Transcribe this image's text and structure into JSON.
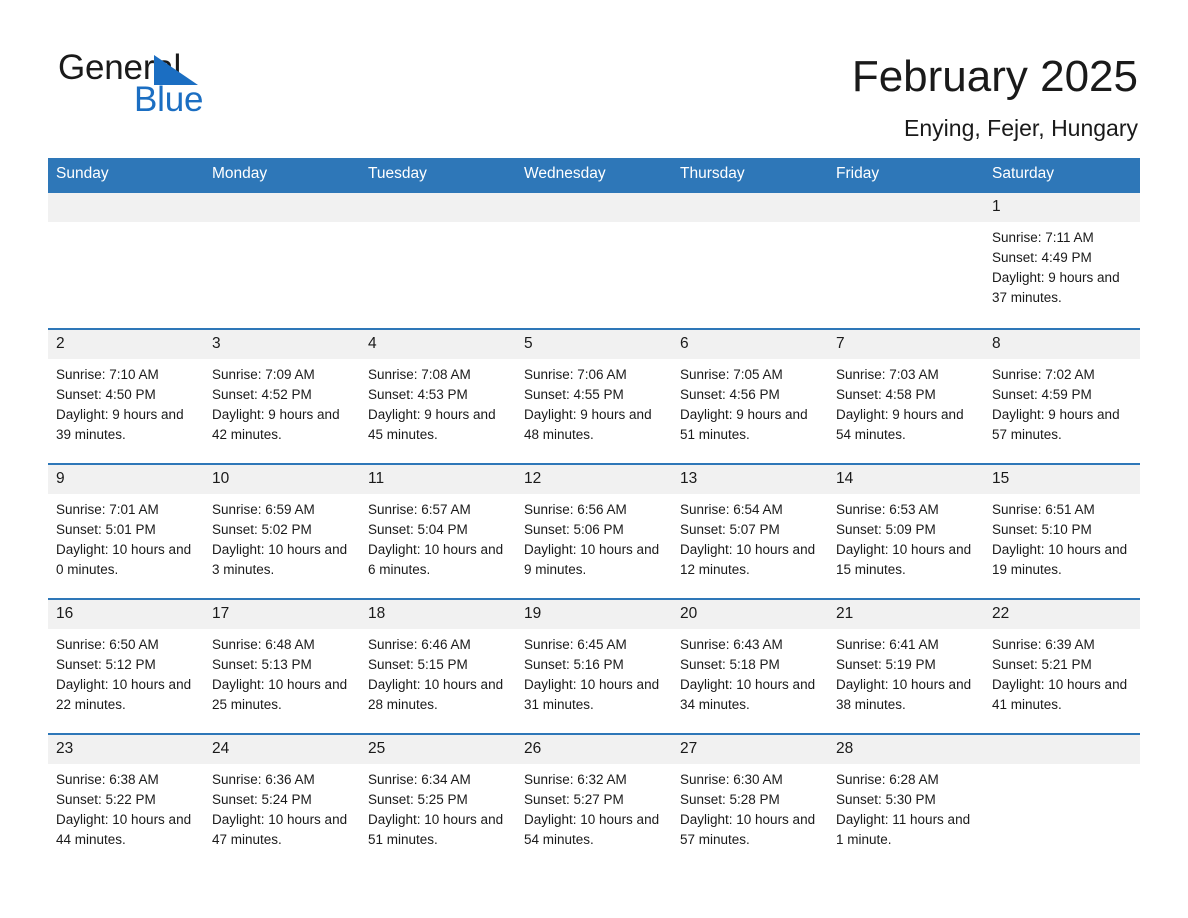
{
  "brand": {
    "word_one": "General",
    "word_two": "Blue",
    "accent_color": "#1b6ec2",
    "triangle_icon": "triangle-flag-icon"
  },
  "header": {
    "month_title": "February 2025",
    "location": "Enying, Fejer, Hungary"
  },
  "calendar": {
    "header_color": "#2e77b8",
    "daynum_background": "#f1f1f1",
    "weekdays": [
      "Sunday",
      "Monday",
      "Tuesday",
      "Wednesday",
      "Thursday",
      "Friday",
      "Saturday"
    ],
    "weeks": [
      [
        {
          "day": "",
          "sunrise": "",
          "sunset": "",
          "daylight": ""
        },
        {
          "day": "",
          "sunrise": "",
          "sunset": "",
          "daylight": ""
        },
        {
          "day": "",
          "sunrise": "",
          "sunset": "",
          "daylight": ""
        },
        {
          "day": "",
          "sunrise": "",
          "sunset": "",
          "daylight": ""
        },
        {
          "day": "",
          "sunrise": "",
          "sunset": "",
          "daylight": ""
        },
        {
          "day": "",
          "sunrise": "",
          "sunset": "",
          "daylight": ""
        },
        {
          "day": "1",
          "sunrise": "Sunrise: 7:11 AM",
          "sunset": "Sunset: 4:49 PM",
          "daylight": "Daylight: 9 hours and 37 minutes."
        }
      ],
      [
        {
          "day": "2",
          "sunrise": "Sunrise: 7:10 AM",
          "sunset": "Sunset: 4:50 PM",
          "daylight": "Daylight: 9 hours and 39 minutes."
        },
        {
          "day": "3",
          "sunrise": "Sunrise: 7:09 AM",
          "sunset": "Sunset: 4:52 PM",
          "daylight": "Daylight: 9 hours and 42 minutes."
        },
        {
          "day": "4",
          "sunrise": "Sunrise: 7:08 AM",
          "sunset": "Sunset: 4:53 PM",
          "daylight": "Daylight: 9 hours and 45 minutes."
        },
        {
          "day": "5",
          "sunrise": "Sunrise: 7:06 AM",
          "sunset": "Sunset: 4:55 PM",
          "daylight": "Daylight: 9 hours and 48 minutes."
        },
        {
          "day": "6",
          "sunrise": "Sunrise: 7:05 AM",
          "sunset": "Sunset: 4:56 PM",
          "daylight": "Daylight: 9 hours and 51 minutes."
        },
        {
          "day": "7",
          "sunrise": "Sunrise: 7:03 AM",
          "sunset": "Sunset: 4:58 PM",
          "daylight": "Daylight: 9 hours and 54 minutes."
        },
        {
          "day": "8",
          "sunrise": "Sunrise: 7:02 AM",
          "sunset": "Sunset: 4:59 PM",
          "daylight": "Daylight: 9 hours and 57 minutes."
        }
      ],
      [
        {
          "day": "9",
          "sunrise": "Sunrise: 7:01 AM",
          "sunset": "Sunset: 5:01 PM",
          "daylight": "Daylight: 10 hours and 0 minutes."
        },
        {
          "day": "10",
          "sunrise": "Sunrise: 6:59 AM",
          "sunset": "Sunset: 5:02 PM",
          "daylight": "Daylight: 10 hours and 3 minutes."
        },
        {
          "day": "11",
          "sunrise": "Sunrise: 6:57 AM",
          "sunset": "Sunset: 5:04 PM",
          "daylight": "Daylight: 10 hours and 6 minutes."
        },
        {
          "day": "12",
          "sunrise": "Sunrise: 6:56 AM",
          "sunset": "Sunset: 5:06 PM",
          "daylight": "Daylight: 10 hours and 9 minutes."
        },
        {
          "day": "13",
          "sunrise": "Sunrise: 6:54 AM",
          "sunset": "Sunset: 5:07 PM",
          "daylight": "Daylight: 10 hours and 12 minutes."
        },
        {
          "day": "14",
          "sunrise": "Sunrise: 6:53 AM",
          "sunset": "Sunset: 5:09 PM",
          "daylight": "Daylight: 10 hours and 15 minutes."
        },
        {
          "day": "15",
          "sunrise": "Sunrise: 6:51 AM",
          "sunset": "Sunset: 5:10 PM",
          "daylight": "Daylight: 10 hours and 19 minutes."
        }
      ],
      [
        {
          "day": "16",
          "sunrise": "Sunrise: 6:50 AM",
          "sunset": "Sunset: 5:12 PM",
          "daylight": "Daylight: 10 hours and 22 minutes."
        },
        {
          "day": "17",
          "sunrise": "Sunrise: 6:48 AM",
          "sunset": "Sunset: 5:13 PM",
          "daylight": "Daylight: 10 hours and 25 minutes."
        },
        {
          "day": "18",
          "sunrise": "Sunrise: 6:46 AM",
          "sunset": "Sunset: 5:15 PM",
          "daylight": "Daylight: 10 hours and 28 minutes."
        },
        {
          "day": "19",
          "sunrise": "Sunrise: 6:45 AM",
          "sunset": "Sunset: 5:16 PM",
          "daylight": "Daylight: 10 hours and 31 minutes."
        },
        {
          "day": "20",
          "sunrise": "Sunrise: 6:43 AM",
          "sunset": "Sunset: 5:18 PM",
          "daylight": "Daylight: 10 hours and 34 minutes."
        },
        {
          "day": "21",
          "sunrise": "Sunrise: 6:41 AM",
          "sunset": "Sunset: 5:19 PM",
          "daylight": "Daylight: 10 hours and 38 minutes."
        },
        {
          "day": "22",
          "sunrise": "Sunrise: 6:39 AM",
          "sunset": "Sunset: 5:21 PM",
          "daylight": "Daylight: 10 hours and 41 minutes."
        }
      ],
      [
        {
          "day": "23",
          "sunrise": "Sunrise: 6:38 AM",
          "sunset": "Sunset: 5:22 PM",
          "daylight": "Daylight: 10 hours and 44 minutes."
        },
        {
          "day": "24",
          "sunrise": "Sunrise: 6:36 AM",
          "sunset": "Sunset: 5:24 PM",
          "daylight": "Daylight: 10 hours and 47 minutes."
        },
        {
          "day": "25",
          "sunrise": "Sunrise: 6:34 AM",
          "sunset": "Sunset: 5:25 PM",
          "daylight": "Daylight: 10 hours and 51 minutes."
        },
        {
          "day": "26",
          "sunrise": "Sunrise: 6:32 AM",
          "sunset": "Sunset: 5:27 PM",
          "daylight": "Daylight: 10 hours and 54 minutes."
        },
        {
          "day": "27",
          "sunrise": "Sunrise: 6:30 AM",
          "sunset": "Sunset: 5:28 PM",
          "daylight": "Daylight: 10 hours and 57 minutes."
        },
        {
          "day": "28",
          "sunrise": "Sunrise: 6:28 AM",
          "sunset": "Sunset: 5:30 PM",
          "daylight": "Daylight: 11 hours and 1 minute."
        },
        {
          "day": "",
          "sunrise": "",
          "sunset": "",
          "daylight": ""
        }
      ]
    ]
  }
}
